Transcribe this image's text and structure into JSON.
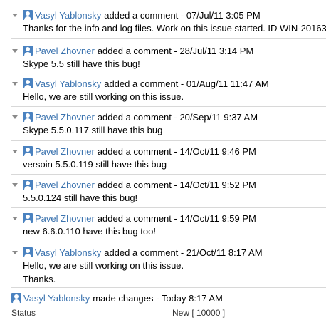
{
  "comments": [
    {
      "author": "Vasyl Yablonsky",
      "meta": "added a comment - 07/Jul/11 3:05 PM",
      "lines": [
        "Thanks for the info and log files. Work on this issue started. ID WIN-20163"
      ]
    },
    {
      "author": "Pavel Zhovner",
      "meta": "added a comment - 28/Jul/11 3:14 PM",
      "lines": [
        "Skype 5.5 still have this bug!"
      ]
    },
    {
      "author": "Vasyl Yablonsky",
      "meta": "added a comment - 01/Aug/11 11:47 AM",
      "lines": [
        "Hello, we are still working on this issue."
      ]
    },
    {
      "author": "Pavel Zhovner",
      "meta": "added a comment - 20/Sep/11 9:37 AM",
      "lines": [
        "Skype 5.5.0.117 still have this bug"
      ]
    },
    {
      "author": "Pavel Zhovner",
      "meta": "added a comment - 14/Oct/11 9:46 PM",
      "lines": [
        "versoin 5.5.0.119 still have this bug"
      ]
    },
    {
      "author": "Pavel Zhovner",
      "meta": "added a comment - 14/Oct/11 9:52 PM",
      "lines": [
        "5.5.0.124 still have this bug!"
      ]
    },
    {
      "author": "Pavel Zhovner",
      "meta": "added a comment - 14/Oct/11 9:59 PM",
      "lines": [
        "new 6.6.0.110 have this bug too!"
      ]
    },
    {
      "author": "Vasyl Yablonsky",
      "meta": "added a comment - 21/Oct/11 8:17 AM",
      "lines": [
        "Hello, we are still working on this issue.",
        "Thanks."
      ]
    }
  ],
  "change": {
    "author": "Vasyl Yablonsky",
    "meta": "made changes - Today 8:17 AM",
    "field_label": "Status",
    "field_value": "New [ 10000 ]"
  },
  "icons": {
    "collapse": "collapse-arrow-icon",
    "avatar": "user-avatar-icon"
  },
  "colors": {
    "link": "#3b73af",
    "separator": "#d8d8d8",
    "avatar": "#4a82c0"
  }
}
